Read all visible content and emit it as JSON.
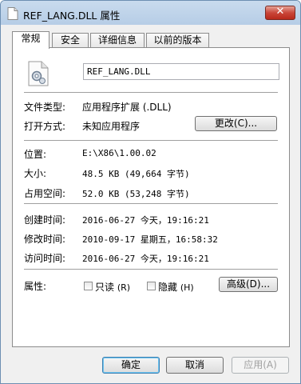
{
  "window": {
    "title": "REF_LANG.DLL 属性",
    "close_label": "✕"
  },
  "tabs": [
    "常规",
    "安全",
    "详细信息",
    "以前的版本"
  ],
  "file": {
    "name": "REF_LANG.DLL",
    "type_label": "文件类型:",
    "type_value": "应用程序扩展 (.DLL)",
    "opens_label": "打开方式:",
    "opens_value": "未知应用程序",
    "change_button": "更改(C)..."
  },
  "location": {
    "location_label": "位置:",
    "location_value": "E:\\X86\\1.00.02",
    "size_label": "大小:",
    "size_value": "48.5 KB (49,664 字节)",
    "disk_label": "占用空间:",
    "disk_value": "52.0 KB (53,248 字节)"
  },
  "dates": {
    "created_label": "创建时间:",
    "created_value": "2016-06-27 今天，19:16:21",
    "modified_label": "修改时间:",
    "modified_value": "2010-09-17 星期五，16:58:32",
    "accessed_label": "访问时间:",
    "accessed_value": "2016-06-27 今天，19:16:21"
  },
  "attributes": {
    "label": "属性:",
    "readonly_label": "只读",
    "readonly_key": "(R)",
    "hidden_label": "隐藏",
    "hidden_key": "(H)",
    "advanced_button": "高级(D)..."
  },
  "footer": {
    "ok": "确定",
    "cancel": "取消",
    "apply": "应用(A)"
  }
}
